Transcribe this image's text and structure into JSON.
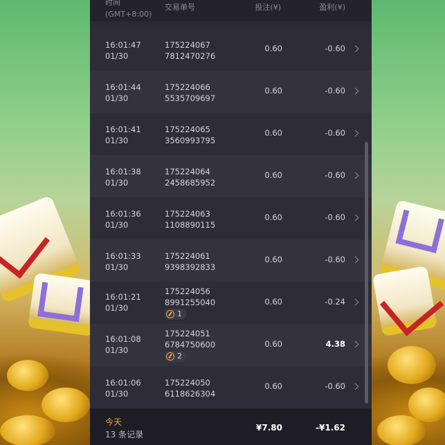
{
  "header": {
    "time_label": "时间",
    "timezone": "(GMT+8:00)",
    "id_label": "交易单号",
    "bet_label": "投注(¥)",
    "pl_label": "盈利(¥)"
  },
  "rows": [
    {
      "time": "16:01:47",
      "date": "01/30",
      "id1": "175224067",
      "id2": "7812470276",
      "bet": "0.60",
      "pl": "-0.60"
    },
    {
      "time": "16:01:44",
      "date": "01/30",
      "id1": "175224066",
      "id2": "5535709697",
      "bet": "0.60",
      "pl": "-0.60"
    },
    {
      "time": "16:01:41",
      "date": "01/30",
      "id1": "175224065",
      "id2": "3560993795",
      "bet": "0.60",
      "pl": "-0.60"
    },
    {
      "time": "16:01:38",
      "date": "01/30",
      "id1": "175224064",
      "id2": "2458685952",
      "bet": "0.60",
      "pl": "-0.60"
    },
    {
      "time": "16:01:36",
      "date": "01/30",
      "id1": "175224063",
      "id2": "1108890115",
      "bet": "0.60",
      "pl": "-0.60"
    },
    {
      "time": "16:01:33",
      "date": "01/30",
      "id1": "175224061",
      "id2": "9398392833",
      "bet": "0.60",
      "pl": "-0.60"
    },
    {
      "time": "16:01:21",
      "date": "01/30",
      "id1": "175224056",
      "id2": "8991255040",
      "bet": "0.60",
      "pl": "-0.24",
      "free_spins": "1"
    },
    {
      "time": "16:01:08",
      "date": "01/30",
      "id1": "175224051",
      "id2": "6784750600",
      "bet": "0.60",
      "pl": "4.38",
      "free_spins": "2"
    },
    {
      "time": "16:01:06",
      "date": "01/30",
      "id1": "175224050",
      "id2": "6118626304",
      "bet": "0.60",
      "pl": "-0.60"
    }
  ],
  "footer": {
    "today": "今天",
    "count": "13 条记录",
    "total_bet": "¥7.80",
    "total_pl": "-¥1.62"
  },
  "colors": {
    "accent": "#f0a93a",
    "panel": "#2b2a35",
    "footer": "#1e1d25"
  }
}
